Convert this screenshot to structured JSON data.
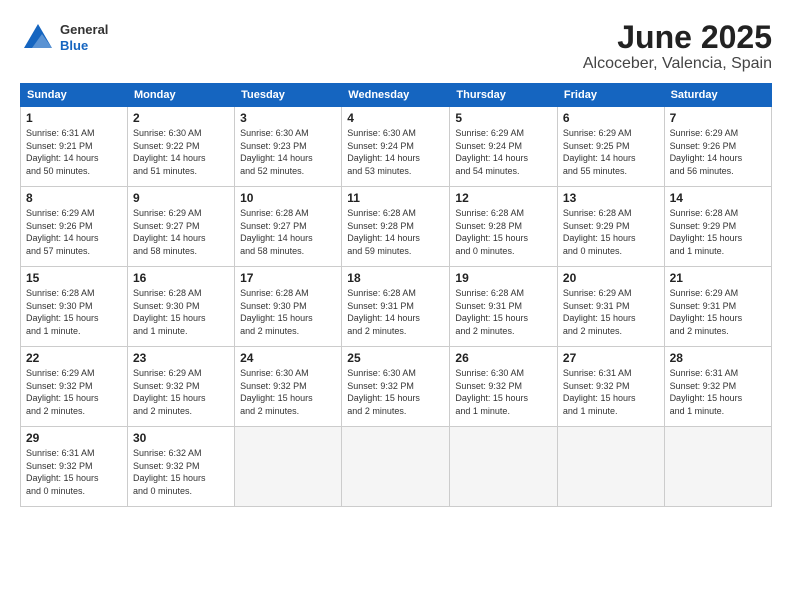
{
  "header": {
    "logo_general": "General",
    "logo_blue": "Blue",
    "month_title": "June 2025",
    "location": "Alcoceber, Valencia, Spain"
  },
  "weekdays": [
    "Sunday",
    "Monday",
    "Tuesday",
    "Wednesday",
    "Thursday",
    "Friday",
    "Saturday"
  ],
  "weeks": [
    [
      {
        "day": "1",
        "sunrise": "6:31 AM",
        "sunset": "9:21 PM",
        "daylight": "14 hours and 50 minutes."
      },
      {
        "day": "2",
        "sunrise": "6:30 AM",
        "sunset": "9:22 PM",
        "daylight": "14 hours and 51 minutes."
      },
      {
        "day": "3",
        "sunrise": "6:30 AM",
        "sunset": "9:23 PM",
        "daylight": "14 hours and 52 minutes."
      },
      {
        "day": "4",
        "sunrise": "6:30 AM",
        "sunset": "9:24 PM",
        "daylight": "14 hours and 53 minutes."
      },
      {
        "day": "5",
        "sunrise": "6:29 AM",
        "sunset": "9:24 PM",
        "daylight": "14 hours and 54 minutes."
      },
      {
        "day": "6",
        "sunrise": "6:29 AM",
        "sunset": "9:25 PM",
        "daylight": "14 hours and 55 minutes."
      },
      {
        "day": "7",
        "sunrise": "6:29 AM",
        "sunset": "9:26 PM",
        "daylight": "14 hours and 56 minutes."
      }
    ],
    [
      {
        "day": "8",
        "sunrise": "6:29 AM",
        "sunset": "9:26 PM",
        "daylight": "14 hours and 57 minutes."
      },
      {
        "day": "9",
        "sunrise": "6:29 AM",
        "sunset": "9:27 PM",
        "daylight": "14 hours and 58 minutes."
      },
      {
        "day": "10",
        "sunrise": "6:28 AM",
        "sunset": "9:27 PM",
        "daylight": "14 hours and 58 minutes."
      },
      {
        "day": "11",
        "sunrise": "6:28 AM",
        "sunset": "9:28 PM",
        "daylight": "14 hours and 59 minutes."
      },
      {
        "day": "12",
        "sunrise": "6:28 AM",
        "sunset": "9:28 PM",
        "daylight": "15 hours and 0 minutes."
      },
      {
        "day": "13",
        "sunrise": "6:28 AM",
        "sunset": "9:29 PM",
        "daylight": "15 hours and 0 minutes."
      },
      {
        "day": "14",
        "sunrise": "6:28 AM",
        "sunset": "9:29 PM",
        "daylight": "15 hours and 1 minute."
      }
    ],
    [
      {
        "day": "15",
        "sunrise": "6:28 AM",
        "sunset": "9:30 PM",
        "daylight": "15 hours and 1 minute."
      },
      {
        "day": "16",
        "sunrise": "6:28 AM",
        "sunset": "9:30 PM",
        "daylight": "15 hours and 1 minute."
      },
      {
        "day": "17",
        "sunrise": "6:28 AM",
        "sunset": "9:30 PM",
        "daylight": "15 hours and 2 minutes."
      },
      {
        "day": "18",
        "sunrise": "6:28 AM",
        "sunset": "9:31 PM",
        "daylight": "14 hours and 2 minutes."
      },
      {
        "day": "19",
        "sunrise": "6:28 AM",
        "sunset": "9:31 PM",
        "daylight": "15 hours and 2 minutes."
      },
      {
        "day": "20",
        "sunrise": "6:29 AM",
        "sunset": "9:31 PM",
        "daylight": "15 hours and 2 minutes."
      },
      {
        "day": "21",
        "sunrise": "6:29 AM",
        "sunset": "9:31 PM",
        "daylight": "15 hours and 2 minutes."
      }
    ],
    [
      {
        "day": "22",
        "sunrise": "6:29 AM",
        "sunset": "9:32 PM",
        "daylight": "15 hours and 2 minutes."
      },
      {
        "day": "23",
        "sunrise": "6:29 AM",
        "sunset": "9:32 PM",
        "daylight": "15 hours and 2 minutes."
      },
      {
        "day": "24",
        "sunrise": "6:30 AM",
        "sunset": "9:32 PM",
        "daylight": "15 hours and 2 minutes."
      },
      {
        "day": "25",
        "sunrise": "6:30 AM",
        "sunset": "9:32 PM",
        "daylight": "15 hours and 2 minutes."
      },
      {
        "day": "26",
        "sunrise": "6:30 AM",
        "sunset": "9:32 PM",
        "daylight": "15 hours and 1 minute."
      },
      {
        "day": "27",
        "sunrise": "6:31 AM",
        "sunset": "9:32 PM",
        "daylight": "15 hours and 1 minute."
      },
      {
        "day": "28",
        "sunrise": "6:31 AM",
        "sunset": "9:32 PM",
        "daylight": "15 hours and 1 minute."
      }
    ],
    [
      {
        "day": "29",
        "sunrise": "6:31 AM",
        "sunset": "9:32 PM",
        "daylight": "15 hours and 0 minutes."
      },
      {
        "day": "30",
        "sunrise": "6:32 AM",
        "sunset": "9:32 PM",
        "daylight": "15 hours and 0 minutes."
      },
      null,
      null,
      null,
      null,
      null
    ]
  ]
}
